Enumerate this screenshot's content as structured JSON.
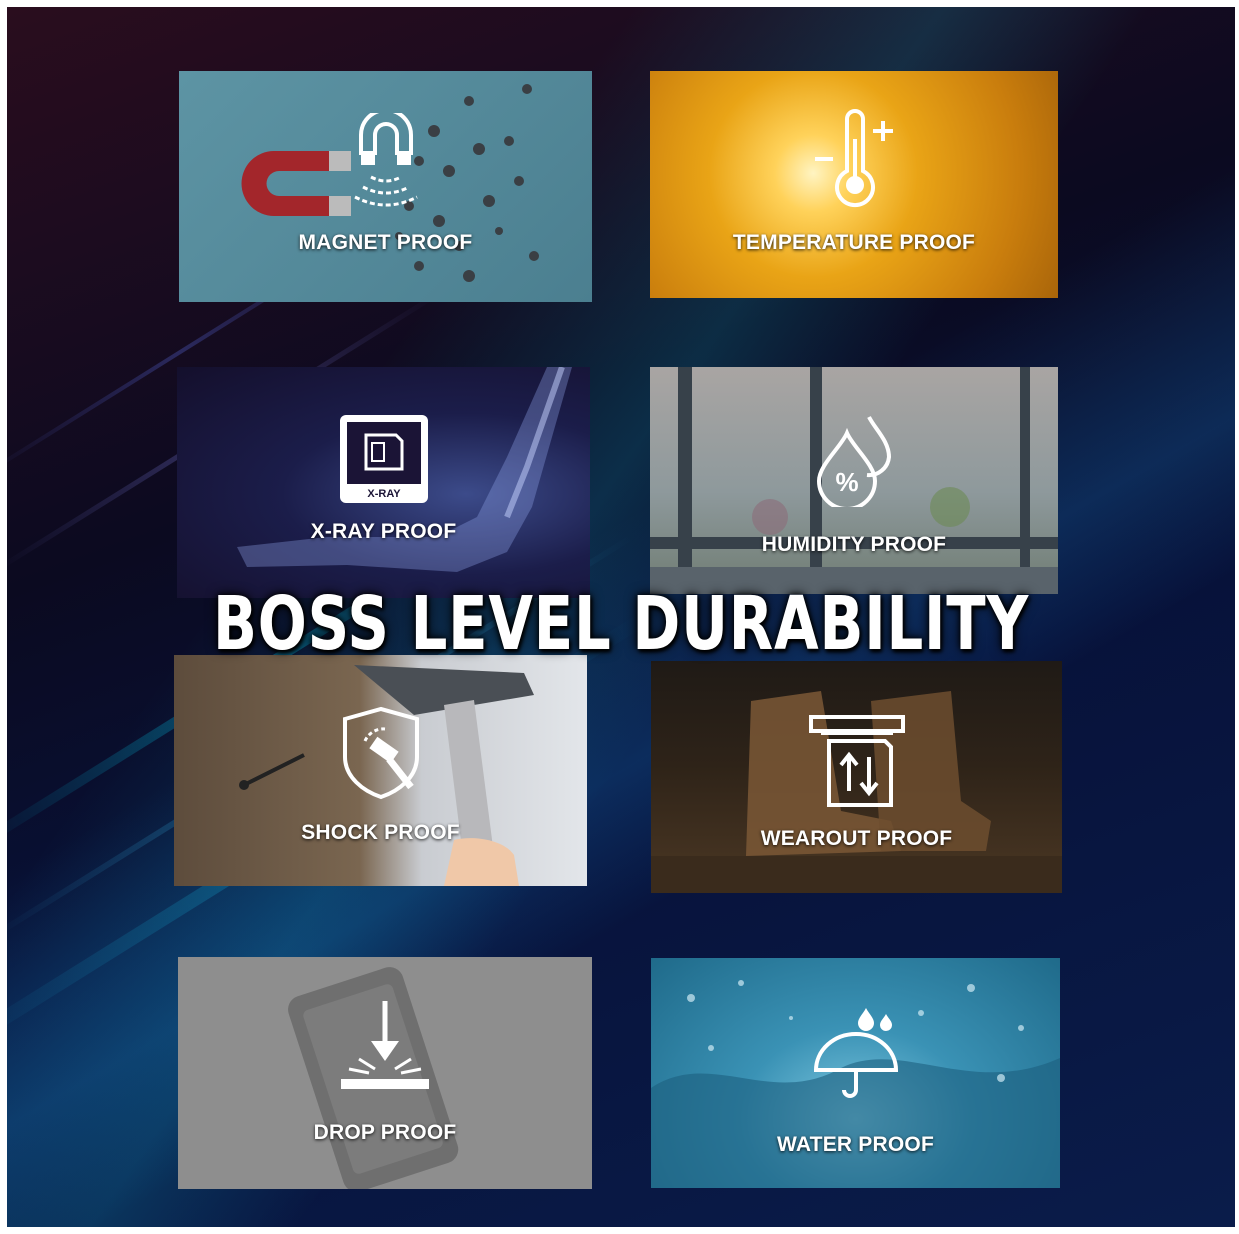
{
  "headline": "BOSS LEVEL DURABILITY",
  "tiles": [
    {
      "label": "MAGNET PROOF",
      "icon": "magnet-icon"
    },
    {
      "label": "TEMPERATURE PROOF",
      "icon": "thermometer-icon"
    },
    {
      "label": "X-RAY PROOF",
      "icon": "xray-card-icon",
      "icon_text": "X-RAY"
    },
    {
      "label": "HUMIDITY PROOF",
      "icon": "humidity-drops-icon",
      "icon_text": "%"
    },
    {
      "label": "SHOCK PROOF",
      "icon": "shield-hammer-icon"
    },
    {
      "label": "WEAROUT PROOF",
      "icon": "card-slot-icon"
    },
    {
      "label": "DROP PROOF",
      "icon": "drop-arrow-icon"
    },
    {
      "label": "WATER PROOF",
      "icon": "umbrella-rain-icon"
    }
  ],
  "colors": {
    "magnet_bg": "#4f8697",
    "temperature_bg": "#e0a21a",
    "xray_bg": "#1b1436",
    "humidity_bg": "#8f9aa0",
    "shock_bg": "#6b5a48",
    "wearout_bg": "#3b2c1e",
    "drop_bg": "#8c8c8c",
    "water_bg": "#2f7fa0"
  }
}
